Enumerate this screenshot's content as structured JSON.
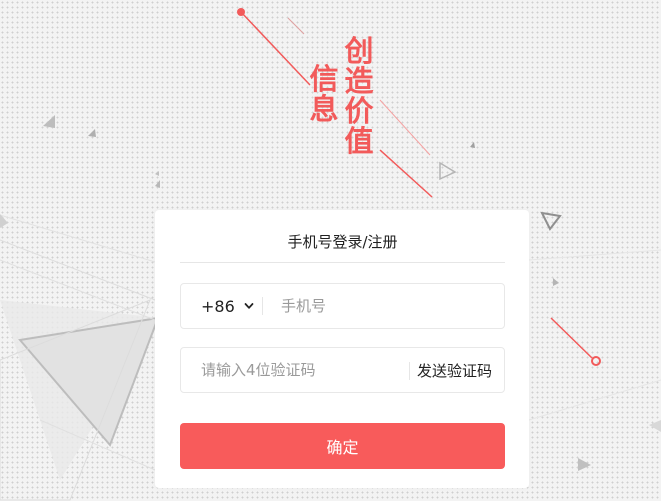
{
  "slogan": {
    "right_line": "创造价值",
    "left_line": "信息"
  },
  "login": {
    "title": "手机号登录/注册",
    "country_code": "+86",
    "phone_placeholder": "手机号",
    "code_placeholder": "请输入4位验证码",
    "send_code_label": "发送验证码",
    "submit_label": "确定"
  },
  "colors": {
    "accent": "#f85b5b",
    "slogan": "#f25a5a",
    "background": "#f3f3f3"
  }
}
